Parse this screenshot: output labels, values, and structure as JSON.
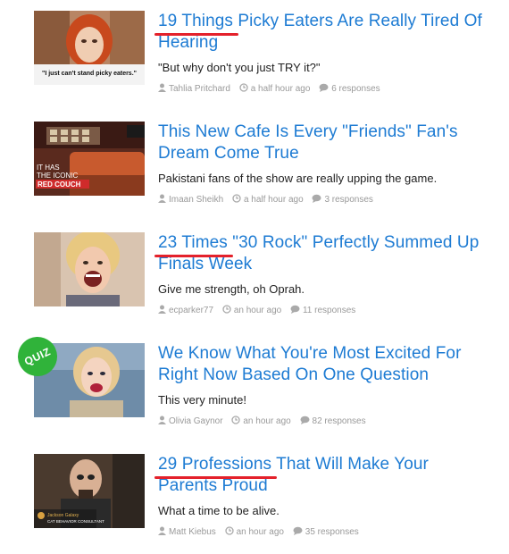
{
  "articles": [
    {
      "title_highlight": "19 Things",
      "title_rest": " Picky Eaters Are Really Tired Of Hearing",
      "description": "\"But why don't you just TRY it?\"",
      "author": "Tahlia Pritchard",
      "time": "a half hour ago",
      "responses": "6 responses",
      "thumb_caption": "\"I just can't stand picky eaters.\""
    },
    {
      "title_highlight": "",
      "title_rest": "This New Cafe Is Every \"Friends\" Fan's Dream Come True",
      "description": "Pakistani fans of the show are really upping the game.",
      "author": "Imaan Sheikh",
      "time": "a half hour ago",
      "responses": "3 responses",
      "thumb_caption_line1": "IT HAS",
      "thumb_caption_line2": "THE ICONIC",
      "thumb_caption_line3": "RED COUCH"
    },
    {
      "title_highlight": "23 Times",
      "title_rest": " \"30 Rock\" Perfectly Summed Up Finals Week",
      "description": "Give me strength, oh Oprah.",
      "author": "ecparker77",
      "time": "an hour ago",
      "responses": "11 responses"
    },
    {
      "title_highlight": "",
      "title_rest": "We Know What You're Most Excited For Right Now Based On One Question",
      "description": "This very minute!",
      "author": "Olivia Gaynor",
      "time": "an hour ago",
      "responses": "82 responses",
      "badge": "QUIZ"
    },
    {
      "title_highlight": "29 Professions",
      "title_rest": " That Will Make Your Parents Proud",
      "description": "What a time to be alive.",
      "author": "Matt Kiebus",
      "time": "an hour ago",
      "responses": "35 responses",
      "thumb_caption_line1": "Jackson Galaxy",
      "thumb_caption_line2": "CAT BEHAVIOR CONSULTANT"
    }
  ],
  "colors": {
    "title": "#1d7bd3",
    "underline": "#e4212b",
    "meta": "#9a9a9a",
    "quiz_badge": "#30b33a"
  },
  "icons": [
    "user-icon",
    "clock-icon",
    "comment-icon"
  ]
}
